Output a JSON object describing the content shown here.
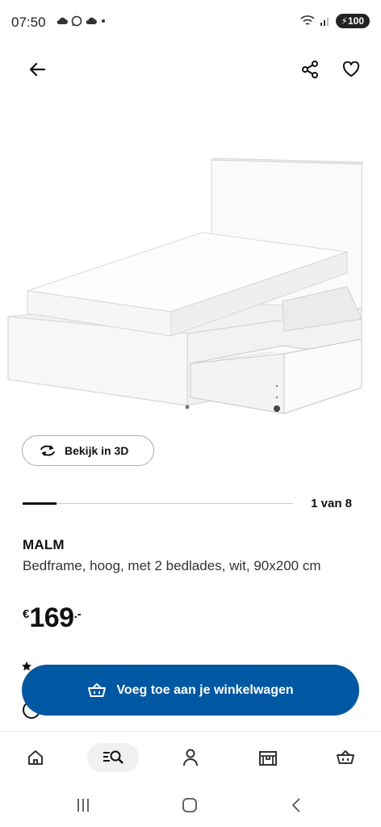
{
  "status_bar": {
    "time": "07:50",
    "battery": "100",
    "icons_left": [
      "cloud-icon",
      "whatsapp-icon",
      "cloud-icon",
      "dot-icon"
    ],
    "icons_right": [
      "wifi-icon",
      "signal-icon",
      "battery-icon"
    ]
  },
  "nav": {
    "icons": [
      "back-arrow-icon",
      "share-icon",
      "heart-icon"
    ]
  },
  "product": {
    "view_3d_label": "Bekijk in 3D",
    "gallery_counter": "1 van 8",
    "gallery_progress": 0.125,
    "name": "MALM",
    "description": "Bedframe, hoog, met 2 bedlades, wit, 90x200 cm",
    "price_currency": "€",
    "price_amount": "169",
    "price_cents": ".-"
  },
  "cart": {
    "add_label": "Voeg toe aan je winkelwagen"
  },
  "tabs": [
    {
      "name": "home",
      "icon": "home-icon"
    },
    {
      "name": "search",
      "icon": "search-icon",
      "active": true
    },
    {
      "name": "profile",
      "icon": "profile-icon"
    },
    {
      "name": "store",
      "icon": "store-icon"
    },
    {
      "name": "cart",
      "icon": "cart-icon"
    }
  ],
  "colors": {
    "primary": "#0058a3",
    "text": "#111111",
    "muted": "#cccccc"
  }
}
